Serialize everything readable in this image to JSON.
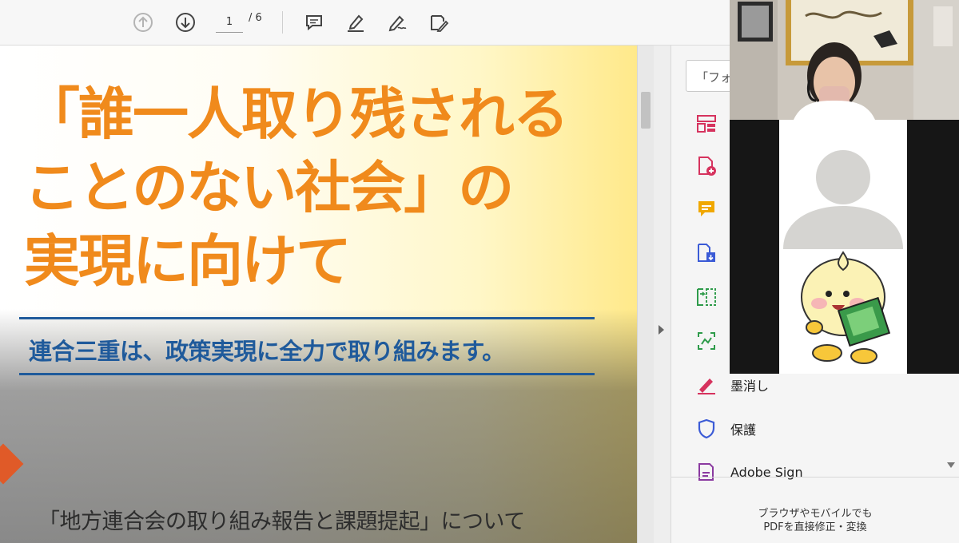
{
  "toolbar": {
    "page_current": "1",
    "page_total": "/ 6",
    "icons": [
      "prev-page-icon",
      "next-page-icon",
      "comment-icon",
      "highlight-icon",
      "sign-icon",
      "edit-icon"
    ]
  },
  "document": {
    "title_line1": "「誰一人取り残される",
    "title_line2": "ことのない社会」の",
    "title_line3": "実現に向けて",
    "subtitle": "連合三重は、政策実現に全力で取り組みます。",
    "footer": "「地方連合会の取り組み報告と課題提起」について",
    "title_color": "#f08a1c",
    "subtitle_color": "#1f5a9b"
  },
  "tools_pane": {
    "search_placeholder": "「フォ",
    "items": [
      {
        "icon": "organize-pages-icon",
        "label": "",
        "color": "#d6335e"
      },
      {
        "icon": "create-pdf-icon",
        "label": "",
        "color": "#d6335e"
      },
      {
        "icon": "comment-tool-icon",
        "label": "",
        "color": "#f0a800"
      },
      {
        "icon": "export-pdf-icon",
        "label": "",
        "color": "#3b5bd6"
      },
      {
        "icon": "compress-pdf-icon",
        "label": "",
        "color": "#2e9b4a"
      },
      {
        "icon": "scan-ocr-icon",
        "label": "",
        "color": "#2e9b4a"
      },
      {
        "icon": "redact-icon",
        "label": "墨消し",
        "color": "#d6335e"
      },
      {
        "icon": "protect-icon",
        "label": "保護",
        "color": "#3b5bd6"
      },
      {
        "icon": "adobe-sign-icon",
        "label": "Adobe Sign",
        "color": "#8a3aa0"
      }
    ],
    "promo_line1": "ブラウザやモバイルでも",
    "promo_line2": "PDFを直接修正・変換"
  }
}
